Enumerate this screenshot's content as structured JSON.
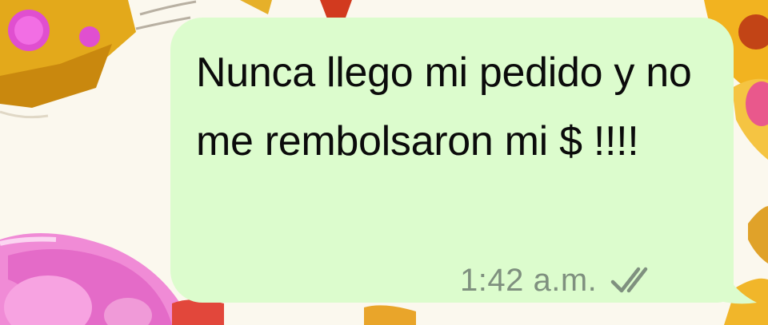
{
  "message": {
    "text": "Nunca llego mi pedido y no me rembolsaron mi $ !!!!",
    "time": "1:42 a.m.",
    "status_icon": "double-check-icon"
  },
  "colors": {
    "bubble": "#dcfccd",
    "text": "#0b0b0b",
    "timestamp": "#7f907f",
    "wallpaper": "#fbf8ee"
  }
}
